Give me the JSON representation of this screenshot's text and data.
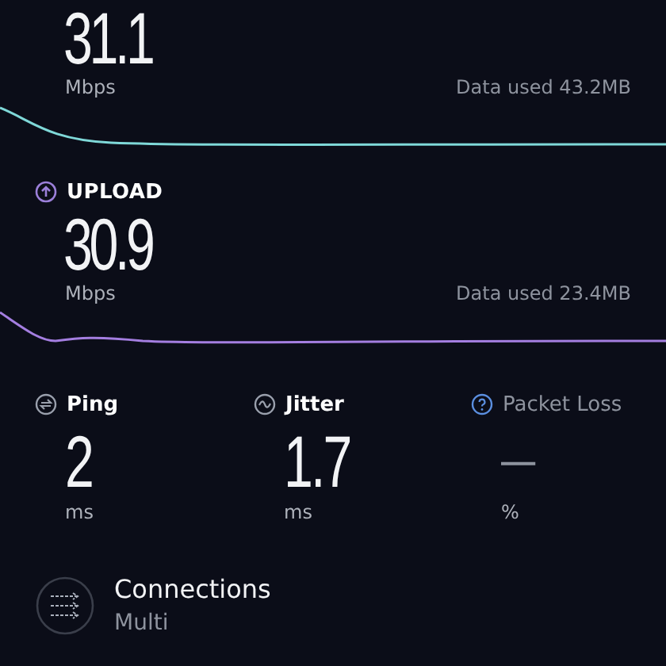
{
  "download": {
    "value": "31.1",
    "unit": "Mbps",
    "data_used": "Data used 43.2MB"
  },
  "upload": {
    "label": "UPLOAD",
    "value": "30.9",
    "unit": "Mbps",
    "data_used": "Data used 23.4MB"
  },
  "metrics": [
    {
      "kind": "ping",
      "label": "Ping",
      "value": "2",
      "unit": "ms"
    },
    {
      "kind": "jitter",
      "label": "Jitter",
      "value": "1.7",
      "unit": "ms"
    },
    {
      "kind": "loss",
      "label": "Packet Loss",
      "value": "—",
      "unit": "%"
    }
  ],
  "connections": {
    "label": "Connections",
    "value": "Multi"
  }
}
